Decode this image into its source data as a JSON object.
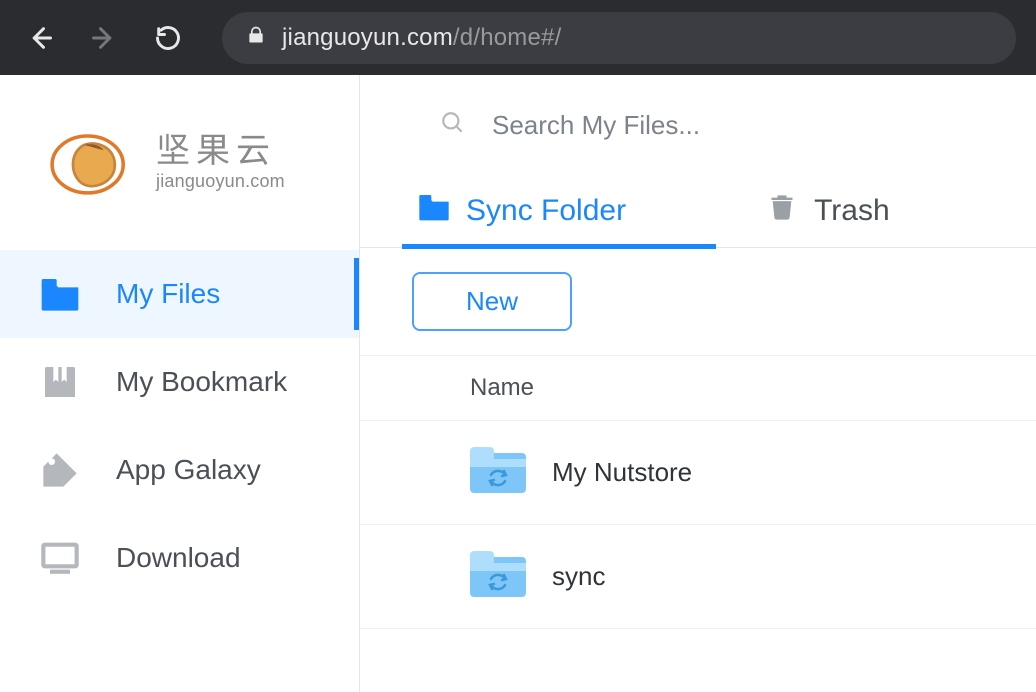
{
  "browser": {
    "url_host": "jianguoyun.com",
    "url_path": "/d/home#/"
  },
  "logo": {
    "cn": "坚果云",
    "en": "jianguoyun.com"
  },
  "sidebar": {
    "items": [
      {
        "label": "My Files",
        "active": true
      },
      {
        "label": "My Bookmark",
        "active": false
      },
      {
        "label": "App Galaxy",
        "active": false
      },
      {
        "label": "Download",
        "active": false
      }
    ]
  },
  "search": {
    "placeholder": "Search My Files..."
  },
  "tabs": [
    {
      "label": "Sync Folder",
      "active": true,
      "icon": "folder"
    },
    {
      "label": "Trash",
      "active": false,
      "icon": "trash"
    }
  ],
  "new_button": "New",
  "list": {
    "header": "Name",
    "items": [
      {
        "name": "My Nutstore",
        "kind": "sync-folder"
      },
      {
        "name": "sync",
        "kind": "sync-folder"
      }
    ]
  },
  "colors": {
    "accent": "#1a87ff"
  }
}
